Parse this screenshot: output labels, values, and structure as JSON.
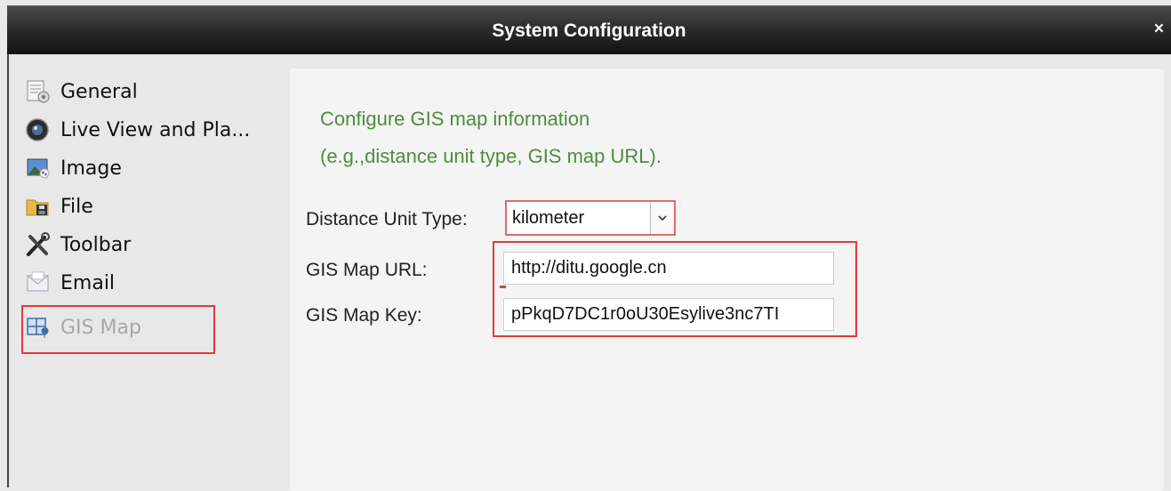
{
  "window": {
    "title": "System Configuration",
    "close_glyph": "×"
  },
  "sidebar": {
    "items": [
      {
        "label": "General",
        "icon": "general-settings-icon"
      },
      {
        "label": "Live View and Pla...",
        "icon": "camera-lens-icon"
      },
      {
        "label": "Image",
        "icon": "image-icon"
      },
      {
        "label": "File",
        "icon": "folder-icon"
      },
      {
        "label": "Toolbar",
        "icon": "tools-icon"
      },
      {
        "label": "Email",
        "icon": "envelope-icon"
      },
      {
        "label": "GIS Map",
        "icon": "gis-map-icon",
        "disabled": true
      }
    ]
  },
  "main": {
    "description_line1": "Configure GIS map information",
    "description_line2": "(e.g.,distance unit type, GIS map URL).",
    "distance_unit_label": "Distance Unit Type:",
    "distance_unit_value": "kilometer",
    "map_url_label": "GIS Map URL:",
    "map_url_value": "http://ditu.google.cn",
    "map_key_label": "GIS Map Key:",
    "map_key_value": "pPkqD7DC1r0oU30Esylive3nc7TI"
  },
  "colors": {
    "description_text": "#4e8d3c",
    "highlight_border": "#e23a3a",
    "title_bar": "#2d2d2d"
  }
}
